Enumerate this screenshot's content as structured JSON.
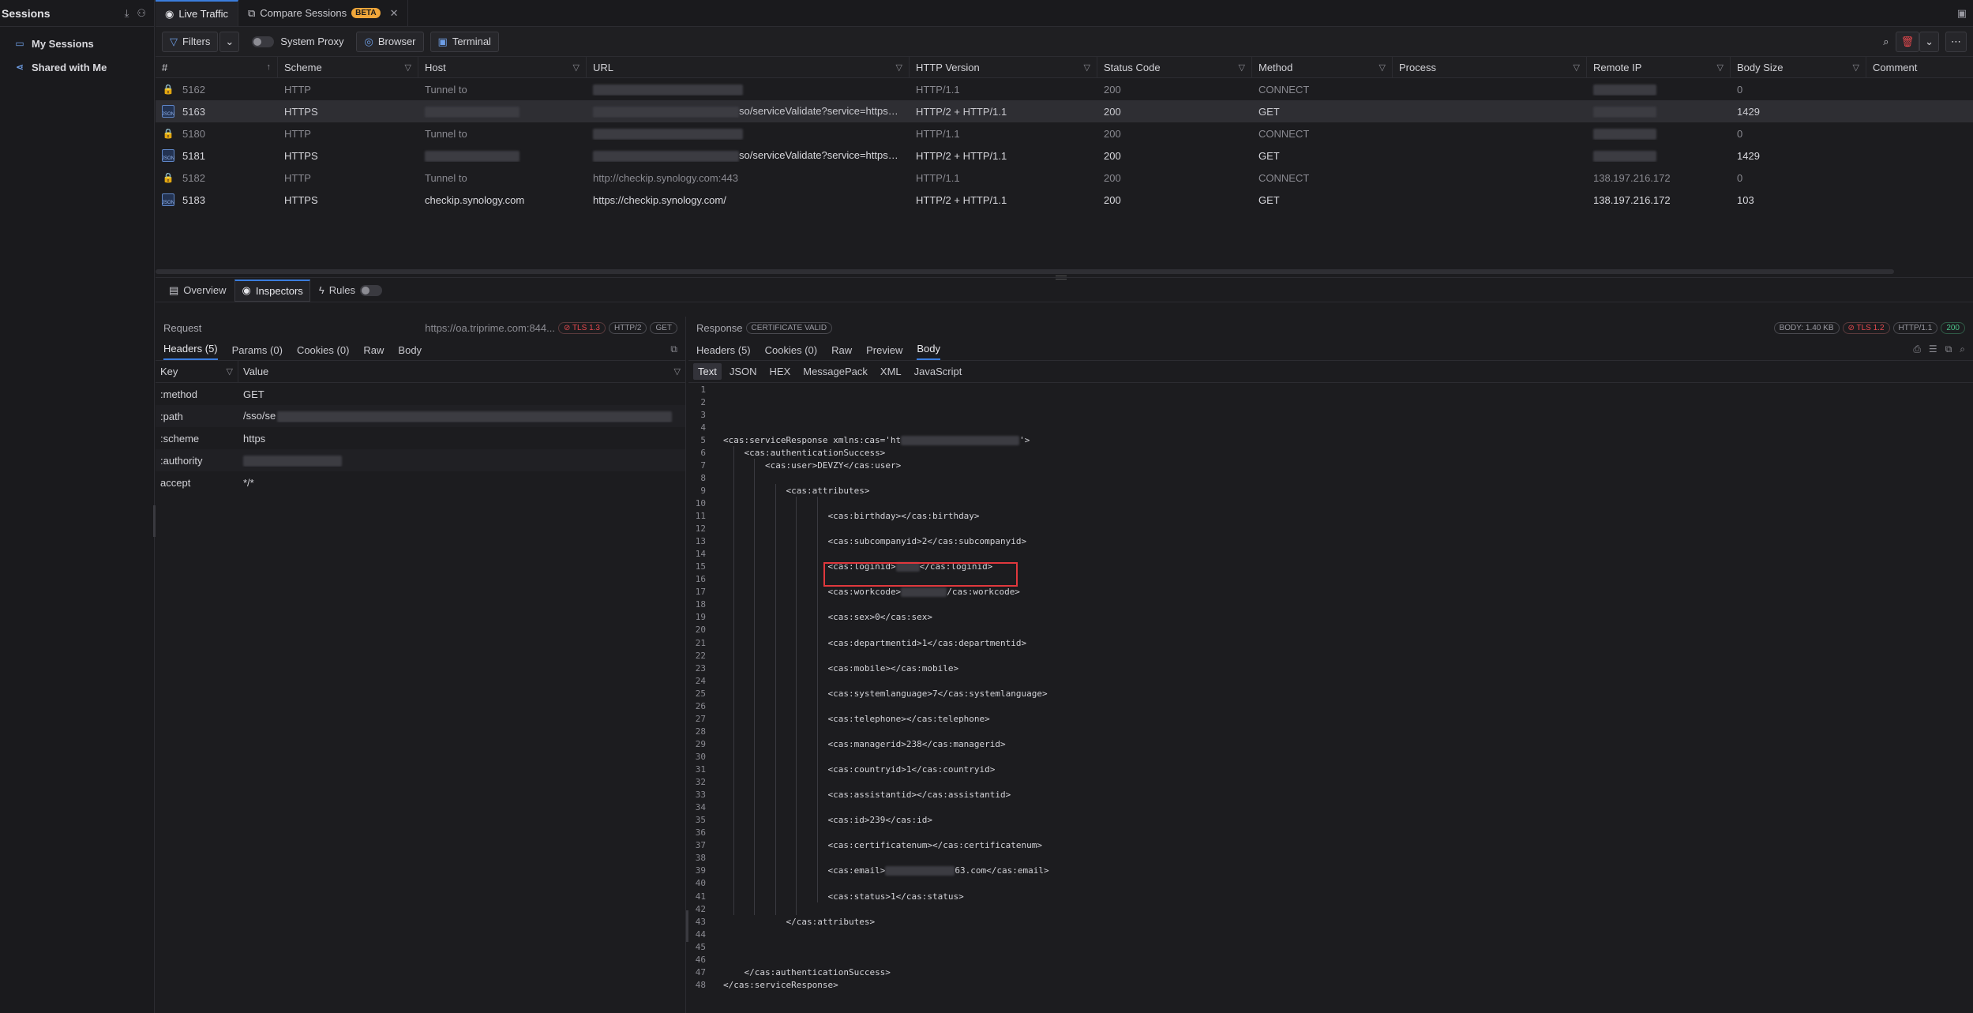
{
  "sidebar": {
    "title": "Sessions",
    "items": [
      {
        "label": "My Sessions",
        "icon": "folder-icon"
      },
      {
        "label": "Shared with Me",
        "icon": "share-icon"
      }
    ]
  },
  "tabs": [
    {
      "label": "Live Traffic",
      "icon": "eye-icon"
    },
    {
      "label": "Compare Sessions",
      "icon": "compare-icon",
      "badge": "BETA"
    }
  ],
  "toolbar": {
    "filters": "Filters",
    "system_proxy": "System Proxy",
    "browser": "Browser",
    "terminal": "Terminal"
  },
  "traffic_table": {
    "columns": [
      "#",
      "Scheme",
      "Host",
      "URL",
      "HTTP Version",
      "Status Code",
      "Method",
      "Process",
      "Remote IP",
      "Body Size",
      "Comment"
    ],
    "rows": [
      {
        "id": "5162",
        "scheme": "HTTP",
        "host": "Tunnel to",
        "url": "",
        "version": "HTTP/1.1",
        "status": "200",
        "method": "CONNECT",
        "process": "",
        "remote_ip": "",
        "body_size": "0",
        "style": "dim",
        "icon": "lock"
      },
      {
        "id": "5163",
        "scheme": "HTTPS",
        "host": "",
        "url": "so/serviceValidate?service=https%3...",
        "version": "HTTP/2 + HTTP/1.1",
        "status": "200",
        "method": "GET",
        "process": "",
        "remote_ip": "",
        "body_size": "1429",
        "style": "sel",
        "icon": "json"
      },
      {
        "id": "5180",
        "scheme": "HTTP",
        "host": "Tunnel to",
        "url": "",
        "version": "HTTP/1.1",
        "status": "200",
        "method": "CONNECT",
        "process": "",
        "remote_ip": "",
        "body_size": "0",
        "style": "dim",
        "icon": "lock"
      },
      {
        "id": "5181",
        "scheme": "HTTPS",
        "host": "",
        "url": "so/serviceValidate?service=https%3...",
        "version": "HTTP/2 + HTTP/1.1",
        "status": "200",
        "method": "GET",
        "process": "",
        "remote_ip": "",
        "body_size": "1429",
        "style": "bright",
        "icon": "json"
      },
      {
        "id": "5182",
        "scheme": "HTTP",
        "host": "Tunnel to",
        "url": "http://checkip.synology.com:443",
        "version": "HTTP/1.1",
        "status": "200",
        "method": "CONNECT",
        "process": "",
        "remote_ip": "138.197.216.172",
        "body_size": "0",
        "style": "dim",
        "icon": "lock"
      },
      {
        "id": "5183",
        "scheme": "HTTPS",
        "host": "checkip.synology.com",
        "url": "https://checkip.synology.com/",
        "version": "HTTP/2 + HTTP/1.1",
        "status": "200",
        "method": "GET",
        "process": "",
        "remote_ip": "138.197.216.172",
        "body_size": "103",
        "style": "bright",
        "icon": "json"
      }
    ]
  },
  "bottom_tabs": {
    "overview": "Overview",
    "inspectors": "Inspectors",
    "rules": "Rules"
  },
  "request": {
    "title": "Request",
    "url": "https://oa.triprime.com:844...",
    "pills": [
      "TLS 1.3",
      "HTTP/2",
      "GET"
    ],
    "tabs": [
      "Headers (5)",
      "Params (0)",
      "Cookies (0)",
      "Raw",
      "Body"
    ],
    "kv_head": {
      "key": "Key",
      "value": "Value"
    },
    "headers": [
      {
        "key": ":method",
        "value": "GET"
      },
      {
        "key": ":path",
        "value": "/sso/se"
      },
      {
        "key": ":scheme",
        "value": "https"
      },
      {
        "key": ":authority",
        "value": ""
      },
      {
        "key": "accept",
        "value": "*/*"
      }
    ]
  },
  "response": {
    "title": "Response",
    "cert": "CERTIFICATE VALID",
    "pills": [
      "BODY: 1.40 KB",
      "TLS 1.2",
      "HTTP/1.1",
      "200"
    ],
    "tabs": [
      "Headers (5)",
      "Cookies (0)",
      "Raw",
      "Preview",
      "Body"
    ],
    "formats": [
      "Text",
      "JSON",
      "HEX",
      "MessagePack",
      "XML",
      "JavaScript"
    ],
    "lines": [
      {
        "n": "1",
        "t": "",
        "i": 0
      },
      {
        "n": "2",
        "t": "",
        "i": 0
      },
      {
        "n": "3",
        "t": "",
        "i": 0
      },
      {
        "n": "4",
        "t": "",
        "i": 0
      },
      {
        "n": "5",
        "t": "<cas:serviceResponse xmlns:cas='ht",
        "i": 0,
        "blur": 150,
        "tail": "'>"
      },
      {
        "n": "6",
        "t": "<cas:authenticationSuccess>",
        "i": 1
      },
      {
        "n": "7",
        "t": "<cas:user>DEVZY</cas:user>",
        "i": 2
      },
      {
        "n": "8",
        "t": "",
        "i": 0
      },
      {
        "n": "9",
        "t": "<cas:attributes>",
        "i": 3
      },
      {
        "n": "10",
        "t": "",
        "i": 0
      },
      {
        "n": "11",
        "t": "<cas:birthday></cas:birthday>",
        "i": 5
      },
      {
        "n": "12",
        "t": "",
        "i": 0
      },
      {
        "n": "13",
        "t": "<cas:subcompanyid>2</cas:subcompanyid>",
        "i": 5
      },
      {
        "n": "14",
        "t": "",
        "i": 0
      },
      {
        "n": "15",
        "t": "<cas:loginid>",
        "i": 5,
        "blur": 30,
        "tail": "</cas:loginid>"
      },
      {
        "n": "16",
        "t": "",
        "i": 0
      },
      {
        "n": "17",
        "t": "<cas:workcode>",
        "i": 5,
        "blur": 58,
        "tail": "/cas:workcode>"
      },
      {
        "n": "18",
        "t": "",
        "i": 0
      },
      {
        "n": "19",
        "t": "<cas:sex>0</cas:sex>",
        "i": 5
      },
      {
        "n": "20",
        "t": "",
        "i": 0
      },
      {
        "n": "21",
        "t": "<cas:departmentid>1</cas:departmentid>",
        "i": 5
      },
      {
        "n": "22",
        "t": "",
        "i": 0
      },
      {
        "n": "23",
        "t": "<cas:mobile></cas:mobile>",
        "i": 5
      },
      {
        "n": "24",
        "t": "",
        "i": 0
      },
      {
        "n": "25",
        "t": "<cas:systemlanguage>7</cas:systemlanguage>",
        "i": 5
      },
      {
        "n": "26",
        "t": "",
        "i": 0
      },
      {
        "n": "27",
        "t": "<cas:telephone></cas:telephone>",
        "i": 5
      },
      {
        "n": "28",
        "t": "",
        "i": 0
      },
      {
        "n": "29",
        "t": "<cas:managerid>238</cas:managerid>",
        "i": 5
      },
      {
        "n": "30",
        "t": "",
        "i": 0
      },
      {
        "n": "31",
        "t": "<cas:countryid>1</cas:countryid>",
        "i": 5
      },
      {
        "n": "32",
        "t": "",
        "i": 0
      },
      {
        "n": "33",
        "t": "<cas:assistantid></cas:assistantid>",
        "i": 5
      },
      {
        "n": "34",
        "t": "",
        "i": 0
      },
      {
        "n": "35",
        "t": "<cas:id>239</cas:id>",
        "i": 5
      },
      {
        "n": "36",
        "t": "",
        "i": 0
      },
      {
        "n": "37",
        "t": "<cas:certificatenum></cas:certificatenum>",
        "i": 5
      },
      {
        "n": "38",
        "t": "",
        "i": 0
      },
      {
        "n": "39",
        "t": "<cas:email>",
        "i": 5,
        "blur": 88,
        "tail": "63.com</cas:email>"
      },
      {
        "n": "40",
        "t": "",
        "i": 0
      },
      {
        "n": "41",
        "t": "<cas:status>1</cas:status>",
        "i": 5
      },
      {
        "n": "42",
        "t": "",
        "i": 0
      },
      {
        "n": "43",
        "t": "</cas:attributes>",
        "i": 3
      },
      {
        "n": "44",
        "t": "",
        "i": 0
      },
      {
        "n": "45",
        "t": "",
        "i": 0
      },
      {
        "n": "46",
        "t": "",
        "i": 0
      },
      {
        "n": "47",
        "t": "</cas:authenticationSuccess>",
        "i": 1
      },
      {
        "n": "48",
        "t": "</cas:serviceResponse>",
        "i": 0
      }
    ]
  }
}
